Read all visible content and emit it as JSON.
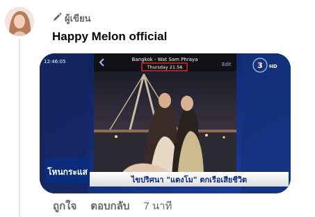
{
  "comment": {
    "author_badge": "ผู้เขียน",
    "author_name": "Happy Melon official",
    "actions": {
      "like": "ถูกใจ",
      "reply": "ตอบกลับ",
      "timestamp": "7 นาที"
    }
  },
  "media": {
    "status_time": "12:46:05",
    "location": "Bangkok - Wat Sam Phraya",
    "photo_time": "Thursday 21:56",
    "edit_label": "Edit",
    "channel_logo": "3",
    "channel_hd": "HD",
    "news_logo": "โหนกระแส",
    "headline": "ไขปริศนา \"แตงโม\" ตกเรือเสียชีวิต"
  },
  "icons": {
    "badge_icon": "pencil-icon",
    "back_icon": "chevron-left-icon"
  },
  "colors": {
    "secondary_text": "#65676b",
    "thread_line": "#e4e6eb",
    "highlight_box": "#ff2a2a",
    "headline_bar": "#f4f4f4"
  }
}
